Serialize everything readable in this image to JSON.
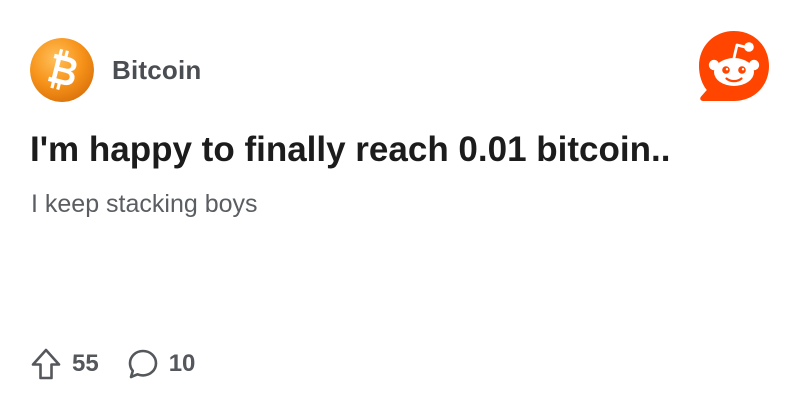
{
  "community": {
    "name": "Bitcoin",
    "avatar_icon": "bitcoin-logo-icon",
    "avatar_color": "#f7931a"
  },
  "brand": {
    "logo_icon": "reddit-snoo-icon",
    "color": "#ff4500"
  },
  "post": {
    "title": "I'm happy to finally reach 0.01 bitcoin..",
    "body": "I keep stacking boys"
  },
  "actions": {
    "upvote_icon": "upvote-arrow-icon",
    "upvotes": "55",
    "comment_icon": "comment-bubble-icon",
    "comments": "10"
  }
}
